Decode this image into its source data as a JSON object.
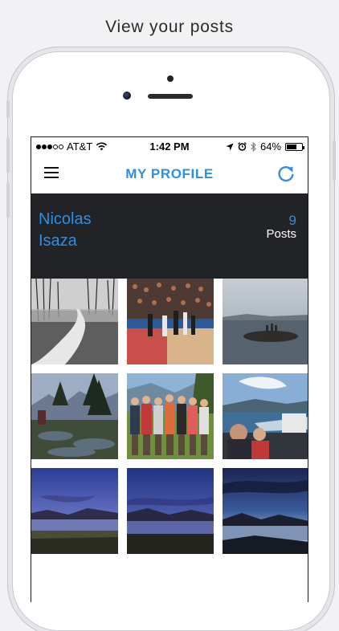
{
  "caption": "View your posts",
  "status_bar": {
    "carrier": "AT&T",
    "time": "1:42 PM",
    "battery": "64%",
    "battery_level": 0.64
  },
  "nav": {
    "title": "MY PROFILE",
    "menu_icon": "hamburger-menu-icon",
    "refresh_icon": "refresh-icon"
  },
  "profile": {
    "first_name": "Nicolas",
    "last_name": "Isaza",
    "post_count": "9",
    "posts_label": "Posts"
  },
  "colors": {
    "accent": "#2d8fe4",
    "header_bg": "#222326"
  },
  "photos": [
    "forest-path-bw",
    "basketball-game",
    "lake-rocks-people",
    "mountain-pine-view",
    "group-of-friends",
    "boat-lake-selfie",
    "lake-dusk",
    "lake-dusk-2",
    "lake-sunset"
  ]
}
